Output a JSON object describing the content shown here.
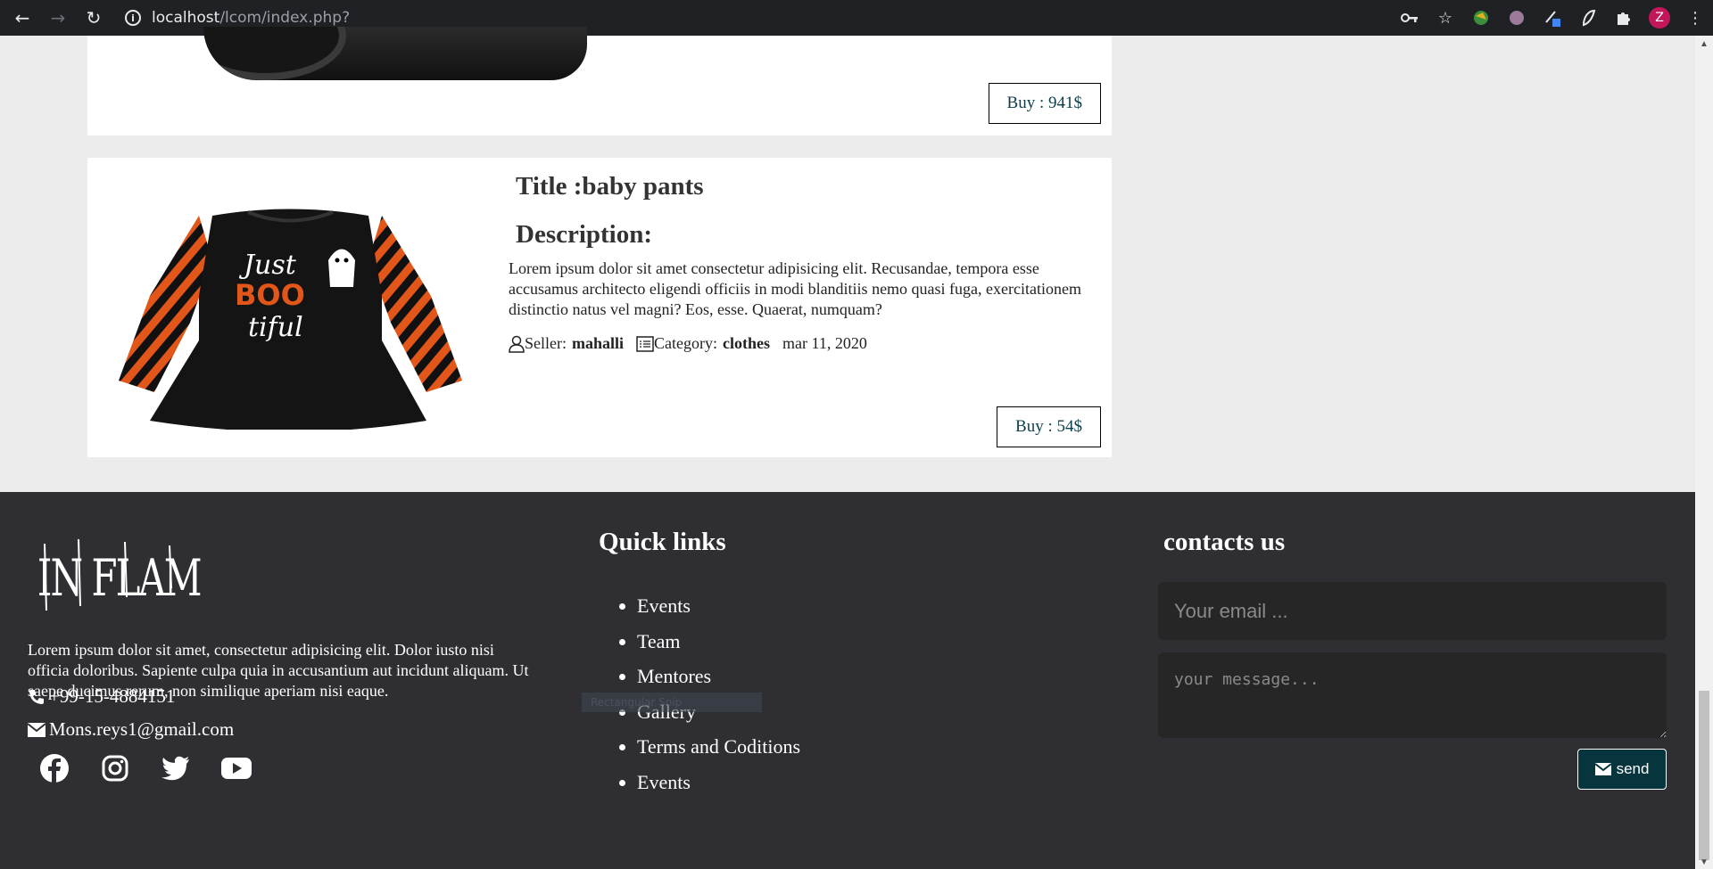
{
  "browser": {
    "url_host": "localhost",
    "url_path": "/lcom/index.php?",
    "profile_initial": "Z",
    "colors": {
      "chrome": "#202124",
      "avatar": "#c2185b"
    }
  },
  "products": [
    {
      "buy_label": "Buy : 941$",
      "image": "camera-lens"
    },
    {
      "image": "halloween-dress",
      "title": "Title :baby pants",
      "description_heading": "Description:",
      "description": "Lorem ipsum dolor sit amet consectetur adipisicing elit. Recusandae, tempora esse accusamus architecto eligendi officiis in modi blanditiis nemo quasi fuga, exercitationem distinctio natus vel magni? Eos, esse. Quaerat, numquam?",
      "seller_label": "Seller:",
      "seller": "mahalli",
      "category_label": "Category:",
      "category": "clothes",
      "date": "mar 11, 2020",
      "buy_label": "Buy : 54$"
    }
  ],
  "footer": {
    "logo_text": "IN FLAMES",
    "about": "Lorem ipsum dolor sit amet, consectetur adipisicing elit. Dolor iusto nisi officia doloribus. Sapiente culpa quia in accusantium aut incidunt aliquam. Ut saepe ducimus rerum, non similique aperiam nisi eaque.",
    "phone": "+99-15-4884151",
    "email": "Mons.reys1@gmail.com",
    "social": [
      "facebook-icon",
      "instagram-icon",
      "twitter-icon",
      "youtube-icon"
    ],
    "quick_links_title": "Quick links",
    "quick_links": [
      "Events",
      "Team",
      "Mentores",
      "Gallery",
      "Terms and Coditions",
      "Events"
    ],
    "snip_overlay": "Rectangular Snip",
    "contact_title": "contacts us",
    "email_placeholder": "Your email ...",
    "message_placeholder": "your message...",
    "send_label": "send",
    "colors": {
      "background": "#2f2e33",
      "send_button": "#07353d"
    }
  }
}
